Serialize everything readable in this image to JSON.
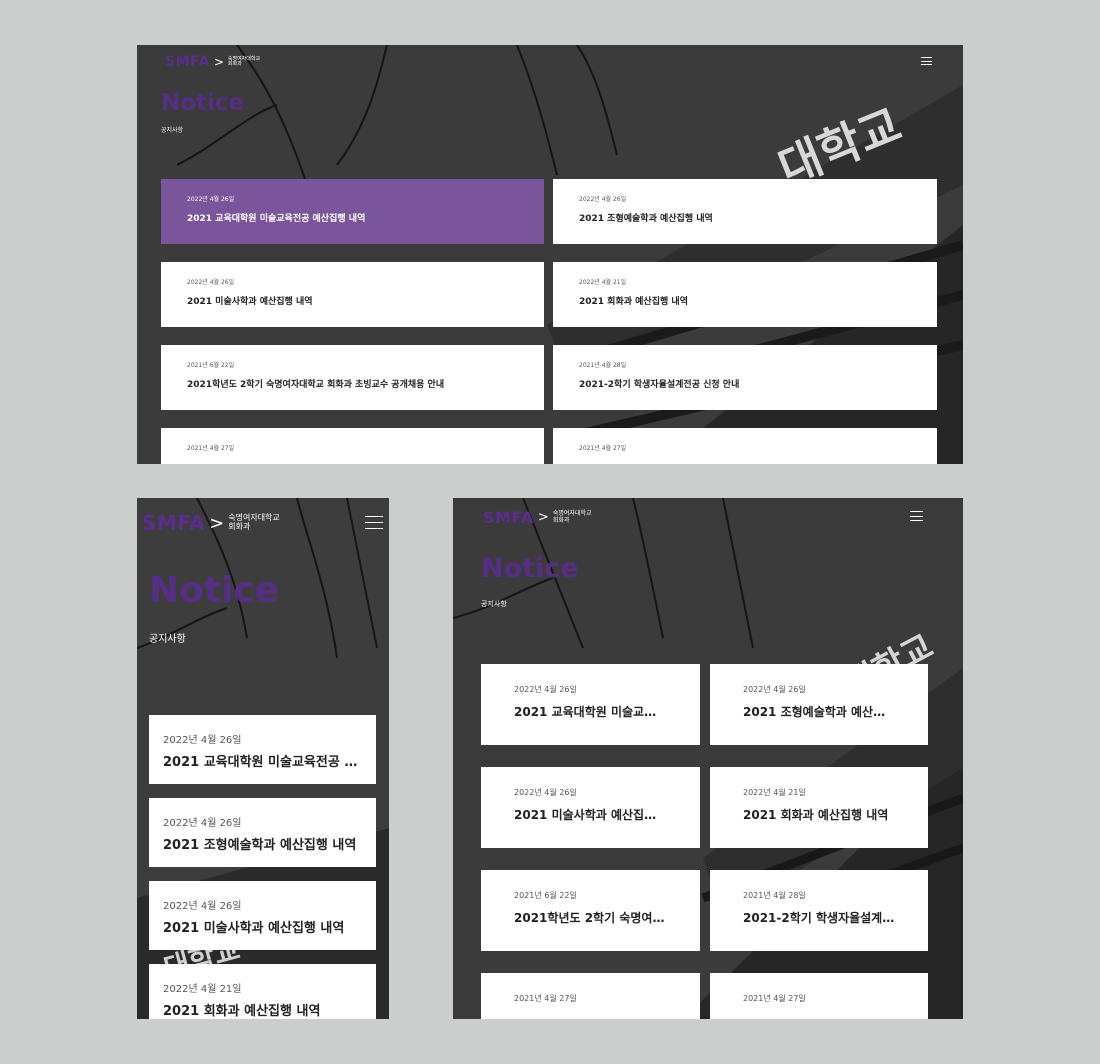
{
  "brand": {
    "mark": "SMFA",
    "sub_line1": "숙명여자대학교",
    "sub_line2": "회화과"
  },
  "page": {
    "title": "Notice",
    "subtitle": "공지사항"
  },
  "notices": [
    {
      "date": "2022년 4월 26일",
      "title": "2021 교육대학원 미술교육전공 예산집행 내역"
    },
    {
      "date": "2022년 4월 26일",
      "title": "2021 조형예술학과 예산집행 내역"
    },
    {
      "date": "2022년 4월 26일",
      "title": "2021 미술사학과 예산집행 내역"
    },
    {
      "date": "2022년 4월 21일",
      "title": "2021 회화과 예산집행 내역"
    },
    {
      "date": "2021년 6월 22일",
      "title": "2021학년도 2학기 숙명여자대학교 회화과 초빙교수 공개채용 안내"
    },
    {
      "date": "2021년 4월 28일",
      "title": "2021-2학기 학생자율설계전공 신청 안내"
    },
    {
      "date": "2021년 4월 27일",
      "title": ""
    },
    {
      "date": "2021년 4월 27일",
      "title": ""
    }
  ],
  "colors": {
    "brand_purple": "#5a2d8e",
    "active_card": "#7b559b",
    "canvas": "#cccecd"
  },
  "icons": {
    "menu": "hamburger-icon",
    "chevron": "chevron-right-icon"
  }
}
